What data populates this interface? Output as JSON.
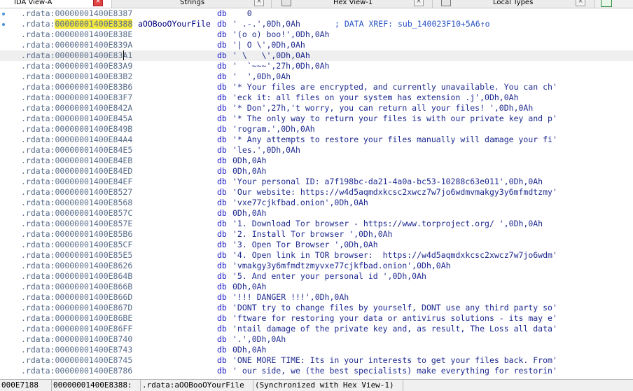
{
  "tabs": [
    {
      "label": "IDA View-A",
      "active": true,
      "close": "×"
    },
    {
      "label": "Strings",
      "active": false,
      "close": "×"
    },
    {
      "label": "Hex View-1",
      "active": false,
      "close": "×"
    },
    {
      "label": "Local Types",
      "active": false,
      "close": "×"
    }
  ],
  "listing": [
    {
      "seg": ".rdata:",
      "addr": "00000001400E8387",
      "name": "",
      "kw": "db",
      "val": "   0",
      "cmt": ""
    },
    {
      "seg": ".rdata:",
      "addr": "00000001400E8388",
      "name": "aOOBooOYourFile",
      "kw": "db",
      "val": "' .-.',0Dh,0Ah",
      "cmt": "; DATA XREF: sub_140023F10+5A6↑o",
      "highlight": true
    },
    {
      "seg": ".rdata:",
      "addr": "00000001400E838E",
      "name": "",
      "kw": "db",
      "val": "'(o o) boo!',0Dh,0Ah",
      "cmt": ""
    },
    {
      "seg": ".rdata:",
      "addr": "00000001400E839A",
      "name": "",
      "kw": "db",
      "val": "'| O \\',0Dh,0Ah",
      "cmt": ""
    },
    {
      "seg": ".rdata:",
      "addr": "00000001400E83A1",
      "name": "",
      "kw": "db",
      "val": "' \\   \\',0Dh,0Ah",
      "cmt": "",
      "selected": true
    },
    {
      "seg": ".rdata:",
      "addr": "00000001400E83A9",
      "name": "",
      "kw": "db",
      "val": "'  `~~~',27h,0Dh,0Ah",
      "cmt": ""
    },
    {
      "seg": ".rdata:",
      "addr": "00000001400E83B2",
      "name": "",
      "kw": "db",
      "val": "'  ',0Dh,0Ah",
      "cmt": ""
    },
    {
      "seg": ".rdata:",
      "addr": "00000001400E83B6",
      "name": "",
      "kw": "db",
      "val": "'* Your files are encrypted, and currently unavailable. You can ch'",
      "cmt": ""
    },
    {
      "seg": ".rdata:",
      "addr": "00000001400E83F7",
      "name": "",
      "kw": "db",
      "val": "'eck it: all files on your system has extension .j',0Dh,0Ah",
      "cmt": ""
    },
    {
      "seg": ".rdata:",
      "addr": "00000001400E842A",
      "name": "",
      "kw": "db",
      "val": "'* Don',27h,'t worry, you can return all your files! ',0Dh,0Ah",
      "cmt": ""
    },
    {
      "seg": ".rdata:",
      "addr": "00000001400E845A",
      "name": "",
      "kw": "db",
      "val": "'* The only way to return your files is with our private key and p'",
      "cmt": ""
    },
    {
      "seg": ".rdata:",
      "addr": "00000001400E849B",
      "name": "",
      "kw": "db",
      "val": "'rogram.',0Dh,0Ah",
      "cmt": ""
    },
    {
      "seg": ".rdata:",
      "addr": "00000001400E84A4",
      "name": "",
      "kw": "db",
      "val": "'* Any attempts to restore your files manually will damage your fi'",
      "cmt": ""
    },
    {
      "seg": ".rdata:",
      "addr": "00000001400E84E5",
      "name": "",
      "kw": "db",
      "val": "'les.',0Dh,0Ah",
      "cmt": ""
    },
    {
      "seg": ".rdata:",
      "addr": "00000001400E84EB",
      "name": "",
      "kw": "db",
      "val": "0Dh,0Ah",
      "cmt": ""
    },
    {
      "seg": ".rdata:",
      "addr": "00000001400E84ED",
      "name": "",
      "kw": "db",
      "val": "0Dh,0Ah",
      "cmt": ""
    },
    {
      "seg": ".rdata:",
      "addr": "00000001400E84EF",
      "name": "",
      "kw": "db",
      "val": "'Your personal ID: a7f198bc-da21-4a0a-bc53-10288c63e011',0Dh,0Ah",
      "cmt": ""
    },
    {
      "seg": ".rdata:",
      "addr": "00000001400E8527",
      "name": "",
      "kw": "db",
      "val": "'Our website: https://w4d5aqmdxkcsc2xwcz7w7jo6wdmvmakgy3y6mfmdtzmy'",
      "cmt": ""
    },
    {
      "seg": ".rdata:",
      "addr": "00000001400E8568",
      "name": "",
      "kw": "db",
      "val": "'vxe77cjkfbad.onion',0Dh,0Ah",
      "cmt": ""
    },
    {
      "seg": ".rdata:",
      "addr": "00000001400E857C",
      "name": "",
      "kw": "db",
      "val": "0Dh,0Ah",
      "cmt": ""
    },
    {
      "seg": ".rdata:",
      "addr": "00000001400E857E",
      "name": "",
      "kw": "db",
      "val": "'1. Download Tor browser - https://www.torproject.org/ ',0Dh,0Ah",
      "cmt": ""
    },
    {
      "seg": ".rdata:",
      "addr": "00000001400E85B6",
      "name": "",
      "kw": "db",
      "val": "'2. Install Tor browser ',0Dh,0Ah",
      "cmt": ""
    },
    {
      "seg": ".rdata:",
      "addr": "00000001400E85CF",
      "name": "",
      "kw": "db",
      "val": "'3. Open Tor Browser ',0Dh,0Ah",
      "cmt": ""
    },
    {
      "seg": ".rdata:",
      "addr": "00000001400E85E5",
      "name": "",
      "kw": "db",
      "val": "'4. Open link in TOR browser:  https://w4d5aqmdxkcsc2xwcz7w7jo6wdm'",
      "cmt": ""
    },
    {
      "seg": ".rdata:",
      "addr": "00000001400E8626",
      "name": "",
      "kw": "db",
      "val": "'vmakgy3y6mfmdtzmyvxe77cjkfbad.onion',0Dh,0Ah",
      "cmt": ""
    },
    {
      "seg": ".rdata:",
      "addr": "00000001400E864B",
      "name": "",
      "kw": "db",
      "val": "'5. And enter your personal id ',0Dh,0Ah",
      "cmt": ""
    },
    {
      "seg": ".rdata:",
      "addr": "00000001400E866B",
      "name": "",
      "kw": "db",
      "val": "0Dh,0Ah",
      "cmt": ""
    },
    {
      "seg": ".rdata:",
      "addr": "00000001400E866D",
      "name": "",
      "kw": "db",
      "val": "'!!! DANGER !!!',0Dh,0Ah",
      "cmt": ""
    },
    {
      "seg": ".rdata:",
      "addr": "00000001400E867D",
      "name": "",
      "kw": "db",
      "val": "'DONT try to change files by yourself, DONT use any third party so'",
      "cmt": ""
    },
    {
      "seg": ".rdata:",
      "addr": "00000001400E86BE",
      "name": "",
      "kw": "db",
      "val": "'ftware for restoring your data or antivirus solutions - its may e'",
      "cmt": ""
    },
    {
      "seg": ".rdata:",
      "addr": "00000001400E86FF",
      "name": "",
      "kw": "db",
      "val": "'ntail damage of the private key and, as result, The Loss all data'",
      "cmt": ""
    },
    {
      "seg": ".rdata:",
      "addr": "00000001400E8740",
      "name": "",
      "kw": "db",
      "val": "'.',0Dh,0Ah",
      "cmt": ""
    },
    {
      "seg": ".rdata:",
      "addr": "00000001400E8743",
      "name": "",
      "kw": "db",
      "val": "0Dh,0Ah",
      "cmt": ""
    },
    {
      "seg": ".rdata:",
      "addr": "00000001400E8745",
      "name": "",
      "kw": "db",
      "val": "'ONE MORE TIME: Its in your interests to get your files back. From'",
      "cmt": ""
    },
    {
      "seg": ".rdata:",
      "addr": "00000001400E8786",
      "name": "",
      "kw": "db",
      "val": "' our side, we (the best specialists) make everything for restorin'",
      "cmt": ""
    }
  ],
  "status": {
    "offset": "000E7188",
    "location": "00000001400E8388:",
    "symbol": ".rdata:aOOBooOYourFile",
    "sync": "(Synchronized with Hex View-1)"
  },
  "colors": {
    "address": "#5a6e8c",
    "highlight": "#f5e83e",
    "keyword": "#1e1ec8",
    "comment": "#2a54c6",
    "close_active": "#e04343"
  }
}
